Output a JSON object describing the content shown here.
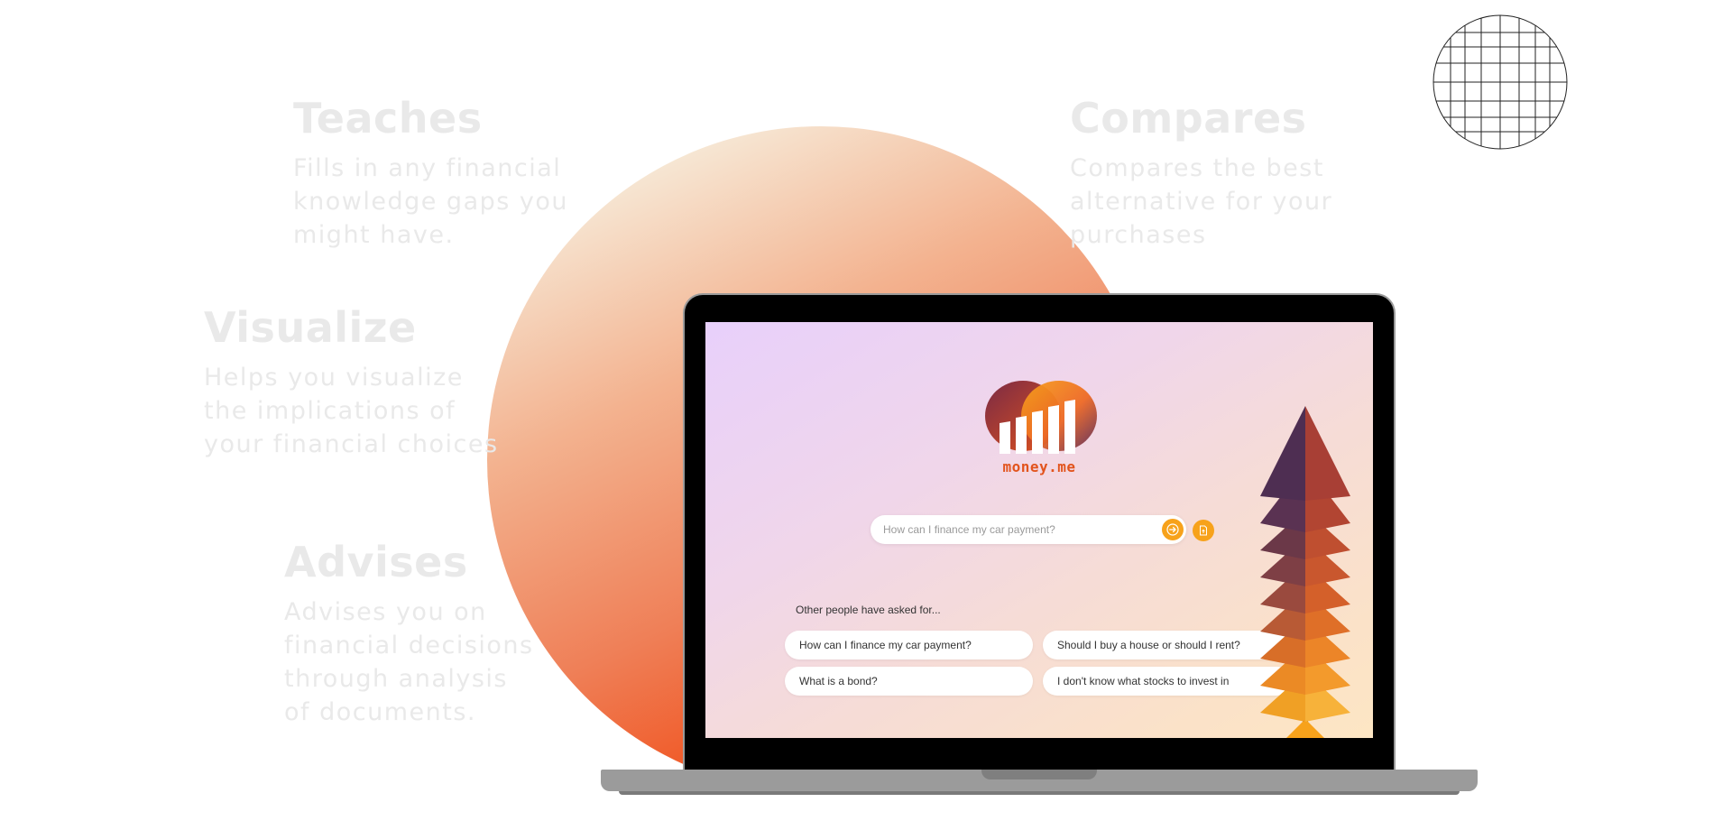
{
  "features": {
    "teaches": {
      "title": "Teaches",
      "desc": "Fills in any financial\nknowledge gaps you\nmight have."
    },
    "compares": {
      "title": "Compares",
      "desc": "Compares the best\nalternative for your\npurchases"
    },
    "visualize": {
      "title": "Visualize",
      "desc": "Helps you visualize\nthe implications of\nyour financial choices"
    },
    "advises": {
      "title": "Advises",
      "desc": "Advises you on\nfinancial decisions\nthrough analysis\nof documents."
    }
  },
  "app": {
    "brand": "money.me",
    "search": {
      "placeholder": "How can I finance my car payment?",
      "value": ""
    },
    "icons": {
      "submit": "arrow-right-icon",
      "upload": "document-upload-icon"
    },
    "suggestions_heading": "Other people have asked for...",
    "suggestions": [
      "How can I finance my car payment?",
      "Should I buy a house or should I rent?",
      "What is a bond?",
      "I don't know what stocks to invest in"
    ]
  },
  "colors": {
    "accent": "#f7a21b",
    "brand_text": "#e2541d",
    "sun_orange": "#f04f1a"
  }
}
